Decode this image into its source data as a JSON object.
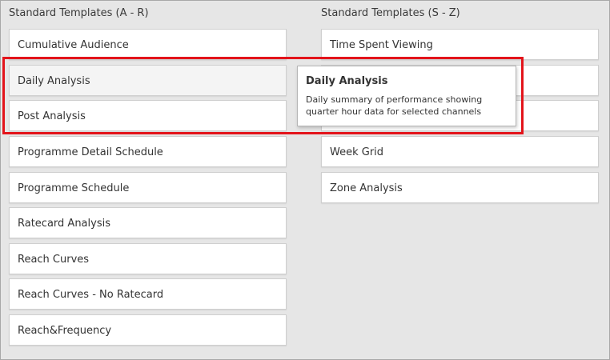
{
  "columns": [
    {
      "title": "Standard Templates (A - R)",
      "items": [
        "Cumulative Audience",
        "Daily Analysis",
        "Post Analysis",
        "Programme Detail Schedule",
        "Programme Schedule",
        "Ratecard Analysis",
        "Reach Curves",
        "Reach Curves - No Ratecard",
        "Reach&Frequency"
      ]
    },
    {
      "title": "Standard Templates (S - Z)",
      "items": [
        "Time Spent Viewing",
        "",
        "",
        "Week Grid",
        "Zone Analysis"
      ]
    }
  ],
  "tooltip": {
    "title": "Daily Analysis",
    "description": "Daily summary of performance showing quarter hour data for selected channels"
  },
  "highlight_color": "#e3141b"
}
